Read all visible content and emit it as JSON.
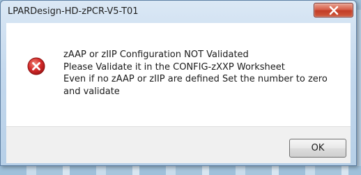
{
  "window": {
    "title": "LPARDesign-HD-zPCR-V5-T01"
  },
  "titlebar": {
    "close_icon": "close-icon"
  },
  "message": {
    "icon": "error-icon",
    "lines": [
      "zAAP or zIIP Configuration NOT Validated",
      "Please Validate it in the CONFIG-zXXP Worksheet",
      "Even if no zAAP or zIIP are defined Set the number to zero and validate"
    ]
  },
  "buttons": {
    "ok_label": "OK"
  },
  "colors": {
    "close_button": "#c23d27",
    "error_icon": "#d42a2a"
  }
}
